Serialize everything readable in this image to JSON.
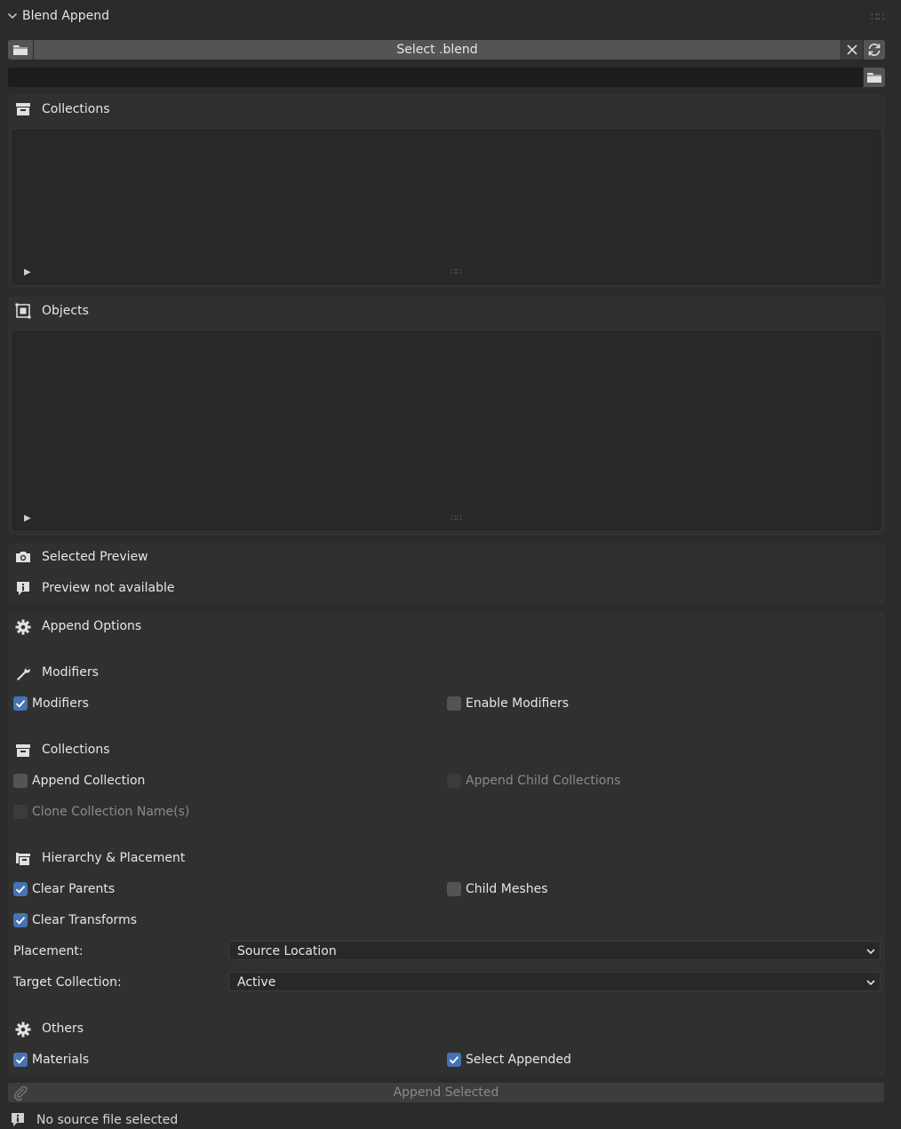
{
  "panel_title": "Blend Append",
  "file_bar": {
    "select_label": "Select .blend",
    "path_value": "",
    "path_placeholder": ""
  },
  "collections_box": {
    "title": "Collections"
  },
  "objects_box": {
    "title": "Objects"
  },
  "preview": {
    "title": "Selected Preview",
    "message": "Preview not available"
  },
  "append_options": {
    "title": "Append Options",
    "modifiers": {
      "title": "Modifiers",
      "modifiers_label": "Modifiers",
      "modifiers_checked": true,
      "enable_modifiers_label": "Enable Modifiers",
      "enable_modifiers_checked": false
    },
    "collections": {
      "title": "Collections",
      "append_collection_label": "Append Collection",
      "append_collection_checked": false,
      "append_child_label": "Append Child Collections",
      "append_child_checked": false,
      "clone_names_label": "Clone Collection Name(s)",
      "clone_names_checked": false
    },
    "hierarchy": {
      "title": "Hierarchy & Placement",
      "clear_parents_label": "Clear Parents",
      "clear_parents_checked": true,
      "child_meshes_label": "Child Meshes",
      "child_meshes_checked": false,
      "clear_transforms_label": "Clear Transforms",
      "clear_transforms_checked": true,
      "placement_label": "Placement:",
      "placement_value": "Source Location",
      "target_label": "Target Collection:",
      "target_value": "Active"
    },
    "others": {
      "title": "Others",
      "materials_label": "Materials",
      "materials_checked": true,
      "select_appended_label": "Select Appended",
      "select_appended_checked": true
    }
  },
  "append_button": "Append Selected",
  "status": "No source file selected",
  "colors": {
    "background": "#2b2b2b",
    "panel": "#303030",
    "list": "#282828",
    "button": "#545454",
    "checkbox_on": "#4772b3",
    "text": "#e6e6e6",
    "text_disabled": "#8a8a8a"
  },
  "icons": {
    "header": "chevron-down-icon",
    "folder": "folder-icon",
    "close": "close-icon",
    "refresh": "refresh-icon",
    "collections": "collection-box-icon",
    "objects": "object-icon",
    "preview": "camera-icon",
    "info": "info-icon",
    "options": "gear-icon",
    "modifiers": "wrench-icon",
    "hierarchy": "outliner-icon",
    "append": "paperclip-icon",
    "checkmark": "checkmark-icon"
  }
}
